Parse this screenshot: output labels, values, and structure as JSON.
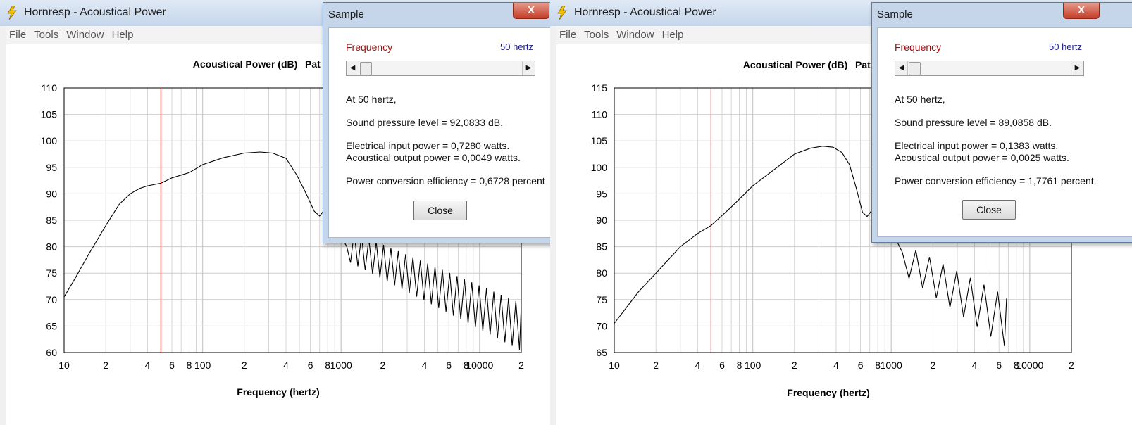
{
  "windows": [
    {
      "title": "Hornresp - Acoustical Power",
      "menu": [
        "File",
        "Tools",
        "Window",
        "Help"
      ],
      "chart_data": {
        "type": "line",
        "title": "Acoustical Power (dB)",
        "title_cut": "Pat",
        "xlabel": "Frequency (hertz)",
        "ylabel": "",
        "xscale": "log",
        "xlim": [
          10,
          20000
        ],
        "ylim": [
          60,
          110
        ],
        "yticks": [
          60,
          65,
          70,
          75,
          80,
          85,
          90,
          95,
          100,
          105,
          110
        ],
        "xtick_labels": [
          {
            "v": 10,
            "t": "10"
          },
          {
            "v": 20,
            "t": "2"
          },
          {
            "v": 40,
            "t": "4"
          },
          {
            "v": 60,
            "t": "6"
          },
          {
            "v": 80,
            "t": "8"
          },
          {
            "v": 100,
            "t": "100"
          },
          {
            "v": 200,
            "t": "2"
          },
          {
            "v": 400,
            "t": "4"
          },
          {
            "v": 600,
            "t": "6"
          },
          {
            "v": 800,
            "t": "8"
          },
          {
            "v": 1000,
            "t": "1000"
          },
          {
            "v": 2000,
            "t": "2"
          },
          {
            "v": 4000,
            "t": "4"
          },
          {
            "v": 6000,
            "t": "6"
          },
          {
            "v": 8000,
            "t": "8"
          },
          {
            "v": 10000,
            "t": "10000"
          },
          {
            "v": 20000,
            "t": "2"
          }
        ],
        "grid": true,
        "marker_frequency": 50,
        "series": [
          {
            "color": "#000000",
            "points": [
              [
                10,
                70.5
              ],
              [
                12,
                74
              ],
              [
                15,
                78.5
              ],
              [
                20,
                84
              ],
              [
                25,
                88
              ],
              [
                30,
                90
              ],
              [
                35,
                91
              ],
              [
                40,
                91.5
              ],
              [
                50,
                92
              ],
              [
                60,
                93
              ],
              [
                80,
                94
              ],
              [
                100,
                95.5
              ],
              [
                140,
                96.8
              ],
              [
                200,
                97.7
              ],
              [
                260,
                97.9
              ],
              [
                320,
                97.7
              ],
              [
                400,
                96.7
              ],
              [
                480,
                93.5
              ],
              [
                560,
                90
              ],
              [
                640,
                86.7
              ],
              [
                700,
                85.8
              ],
              [
                760,
                87
              ],
              [
                820,
                87.3
              ],
              [
                900,
                85
              ],
              [
                1000,
                82
              ],
              [
                1100,
                80
              ]
            ],
            "osc": {
              "f_start": 1100,
              "f_end": 20000,
              "ratio": 1.063,
              "mid_start": 80,
              "mid_end": 64.5,
              "amp_start": 3,
              "amp_end": 4.5,
              "floor": 60
            }
          }
        ]
      },
      "dialog": {
        "title": "Sample",
        "close_x": "X",
        "freq_label": "Frequency",
        "freq_value": "50 hertz",
        "at_line": "At 50 hertz,",
        "spl_line": "Sound pressure level = 92,0833 dB.",
        "elec_line": "Electrical input power = 0,7280 watts.",
        "acou_line": "Acoustical output power = 0,0049 watts.",
        "eff_line": "Power conversion efficiency = 0,6728 percent",
        "close_label": "Close"
      }
    },
    {
      "title": "Hornresp - Acoustical Power",
      "menu": [
        "File",
        "Tools",
        "Window",
        "Help"
      ],
      "chart_data": {
        "type": "line",
        "title": "Acoustical Power (dB)",
        "title_cut": "Pat",
        "xlabel": "Frequency (hertz)",
        "ylabel": "",
        "xscale": "log",
        "xlim": [
          10,
          20000
        ],
        "ylim": [
          65,
          115
        ],
        "yticks": [
          65,
          70,
          75,
          80,
          85,
          90,
          95,
          100,
          105,
          110,
          115
        ],
        "xtick_labels": [
          {
            "v": 10,
            "t": "10"
          },
          {
            "v": 20,
            "t": "2"
          },
          {
            "v": 40,
            "t": "4"
          },
          {
            "v": 60,
            "t": "6"
          },
          {
            "v": 80,
            "t": "8"
          },
          {
            "v": 100,
            "t": "100"
          },
          {
            "v": 200,
            "t": "2"
          },
          {
            "v": 400,
            "t": "4"
          },
          {
            "v": 600,
            "t": "6"
          },
          {
            "v": 800,
            "t": "8"
          },
          {
            "v": 1000,
            "t": "1000"
          },
          {
            "v": 2000,
            "t": "2"
          },
          {
            "v": 4000,
            "t": "4"
          },
          {
            "v": 6000,
            "t": "6"
          },
          {
            "v": 8000,
            "t": "8"
          },
          {
            "v": 10000,
            "t": "10000"
          },
          {
            "v": 20000,
            "t": "2"
          }
        ],
        "grid": true,
        "marker_frequency": 50,
        "series": [
          {
            "color": "#000000",
            "points": [
              [
                10,
                70.5
              ],
              [
                15,
                76.5
              ],
              [
                20,
                80
              ],
              [
                30,
                85
              ],
              [
                40,
                87.5
              ],
              [
                50,
                89
              ],
              [
                70,
                92.5
              ],
              [
                100,
                96.5
              ],
              [
                150,
                100
              ],
              [
                200,
                102.5
              ],
              [
                260,
                103.6
              ],
              [
                320,
                104
              ],
              [
                380,
                103.8
              ],
              [
                440,
                102.8
              ],
              [
                500,
                100.5
              ],
              [
                560,
                96
              ],
              [
                620,
                91.5
              ],
              [
                670,
                90.7
              ],
              [
                730,
                92
              ],
              [
                820,
                92.5
              ],
              [
                950,
                90
              ],
              [
                1100,
                86
              ],
              [
                1200,
                84
              ]
            ],
            "osc": {
              "f_start": 1200,
              "f_end": 6800,
              "ratio": 1.12,
              "mid_start": 82,
              "mid_end": 70,
              "amp_start": 3,
              "amp_end": 5,
              "floor": 65
            }
          }
        ]
      },
      "dialog": {
        "title": "Sample",
        "close_x": "X",
        "freq_label": "Frequency",
        "freq_value": "50 hertz",
        "at_line": "At 50 hertz,",
        "spl_line": "Sound pressure level = 89,0858 dB.",
        "elec_line": "Electrical input power = 0,1383 watts.",
        "acou_line": "Acoustical output power = 0,0025 watts.",
        "eff_line": "Power conversion efficiency = 1,7761 percent.",
        "close_label": "Close"
      }
    }
  ],
  "colors": {
    "marker": "#c00000",
    "grid": "#cccccc",
    "axis": "#000000",
    "dialog_frame": "#c6d6ea",
    "close_x": "#c43d27"
  }
}
